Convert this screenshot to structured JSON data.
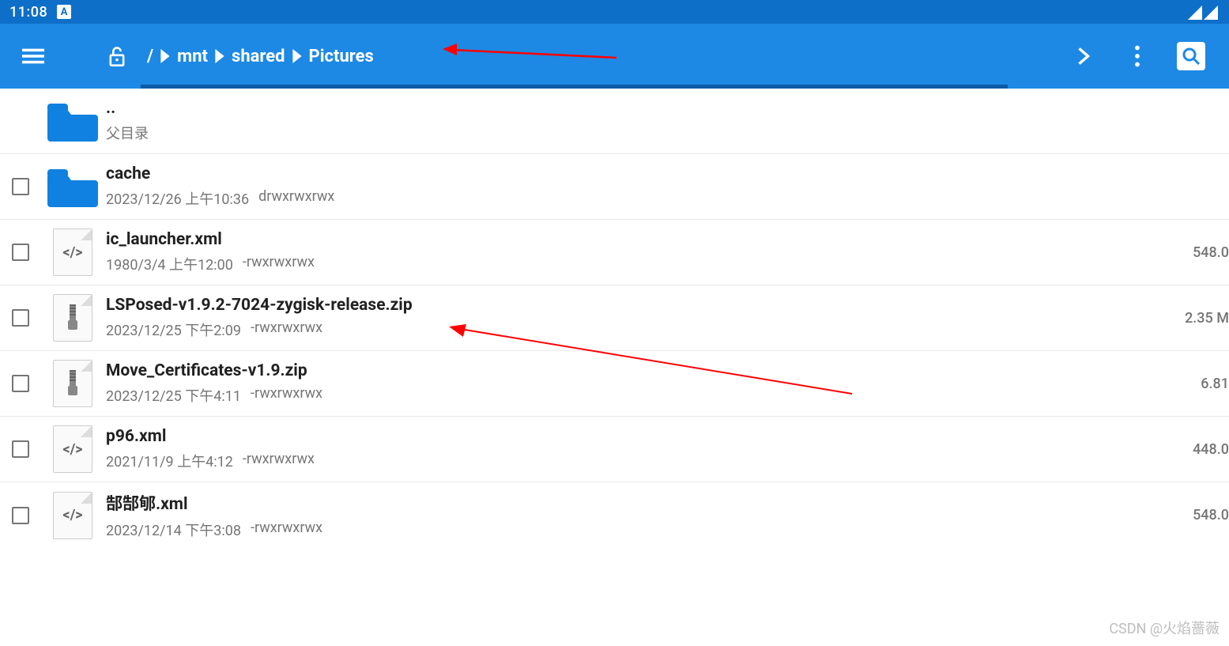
{
  "status": {
    "time": "11:08",
    "indicator": "A"
  },
  "topbar": {
    "breadcrumb_root": "/",
    "segments": [
      "mnt",
      "shared",
      "Pictures"
    ]
  },
  "parent": {
    "name": "..",
    "label": "父目录"
  },
  "items": [
    {
      "type": "folder",
      "name": "cache",
      "date": "2023/12/26 上午10:36",
      "perm": "drwxrwxrwx",
      "size": ""
    },
    {
      "type": "xml",
      "name": "ic_launcher.xml",
      "date": "1980/3/4 上午12:00",
      "perm": "-rwxrwxrwx",
      "size": "548.0"
    },
    {
      "type": "zip",
      "name": "LSPosed-v1.9.2-7024-zygisk-release.zip",
      "date": "2023/12/25 下午2:09",
      "perm": "-rwxrwxrwx",
      "size": "2.35 M"
    },
    {
      "type": "zip",
      "name": "Move_Certificates-v1.9.zip",
      "date": "2023/12/25 下午4:11",
      "perm": "-rwxrwxrwx",
      "size": "6.81 "
    },
    {
      "type": "xml",
      "name": "p96.xml",
      "date": "2021/11/9 上午4:12",
      "perm": "-rwxrwxrwx",
      "size": "448.0"
    },
    {
      "type": "xml",
      "name": "郜郜郇.xml",
      "date": "2023/12/14 下午3:08",
      "perm": "-rwxrwxrwx",
      "size": "548.0"
    }
  ],
  "icons": {
    "xml_label": "</>",
    "zip_label": ""
  },
  "watermark": "CSDN @火焰蔷薇"
}
